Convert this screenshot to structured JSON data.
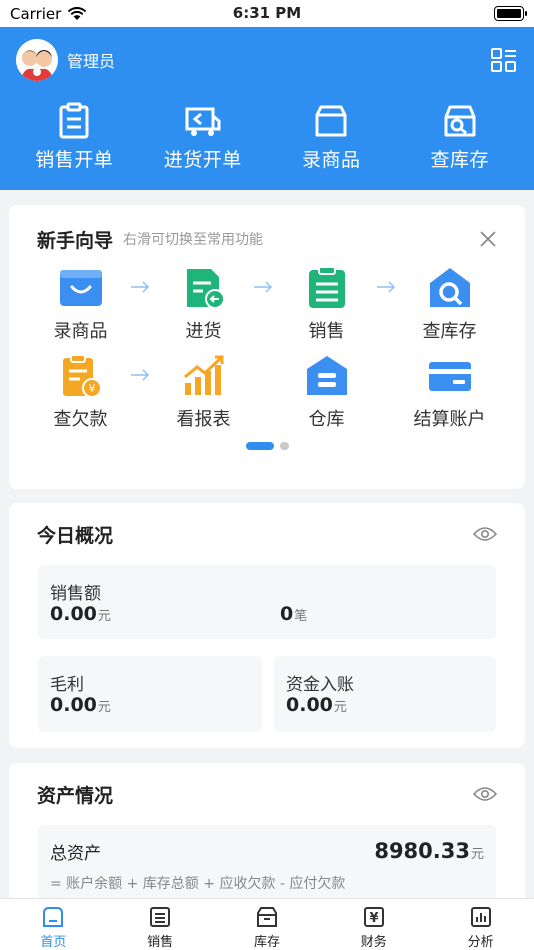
{
  "status_bar": {
    "carrier": "Carrier",
    "time": "6:31 PM"
  },
  "header": {
    "username": "管理员",
    "quick_actions": [
      {
        "label": "销售开单",
        "icon": "clipboard-icon"
      },
      {
        "label": "进货开单",
        "icon": "truck-icon"
      },
      {
        "label": "录商品",
        "icon": "box-icon"
      },
      {
        "label": "查库存",
        "icon": "store-icon"
      }
    ]
  },
  "guide": {
    "title": "新手向导",
    "subtitle": "右滑可切换至常用功能",
    "items": [
      {
        "label": "录商品",
        "icon": "bag-icon",
        "color": "#3a8ff0"
      },
      {
        "label": "进货",
        "icon": "stock-in-icon",
        "color": "#1fb57a"
      },
      {
        "label": "销售",
        "icon": "sales-icon",
        "color": "#1fb57a"
      },
      {
        "label": "查库存",
        "icon": "warehouse-search-icon",
        "color": "#3a8ff0"
      },
      {
        "label": "查欠款",
        "icon": "debt-icon",
        "color": "#f5a623"
      },
      {
        "label": "看报表",
        "icon": "report-icon",
        "color": "#f5a623"
      },
      {
        "label": "仓库",
        "icon": "depot-icon",
        "color": "#3a8ff0"
      },
      {
        "label": "结算账户",
        "icon": "card-icon",
        "color": "#3a8ff0"
      }
    ]
  },
  "today": {
    "title": "今日概况",
    "sales_label": "销售额",
    "sales_value": "0.00",
    "sales_unit": "元",
    "count_value": "0",
    "count_unit": "笔",
    "profit_label": "毛利",
    "profit_value": "0.00",
    "profit_unit": "元",
    "income_label": "资金入账",
    "income_value": "0.00",
    "income_unit": "元"
  },
  "assets": {
    "title": "资产情况",
    "total_label": "总资产",
    "total_value": "8980.33",
    "total_unit": "元",
    "formula": "= 账户余额 + 库存总额 + 应收欠款 - 应付欠款"
  },
  "tabs": [
    {
      "label": "首页",
      "icon": "home-icon",
      "active": true
    },
    {
      "label": "销售",
      "icon": "list-icon",
      "active": false
    },
    {
      "label": "库存",
      "icon": "inventory-icon",
      "active": false
    },
    {
      "label": "财务",
      "icon": "yen-icon",
      "active": false
    },
    {
      "label": "分析",
      "icon": "chart-icon",
      "active": false
    }
  ],
  "colors": {
    "primary": "#2e8ff0",
    "green": "#1fb57a",
    "orange": "#f5a623"
  }
}
